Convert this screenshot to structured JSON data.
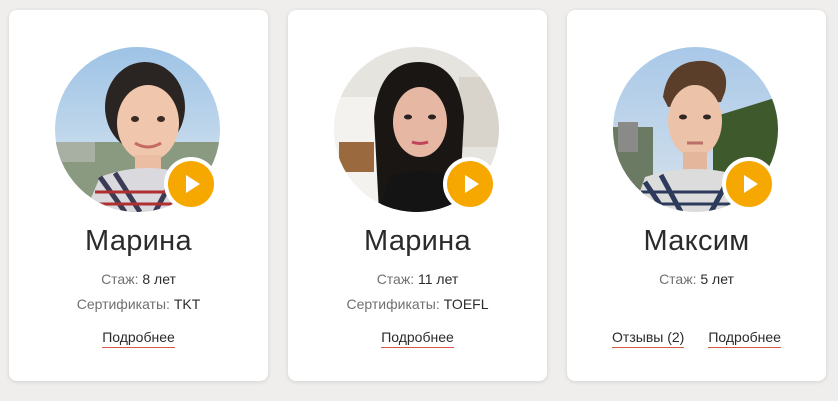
{
  "teachers": [
    {
      "name": "Марина",
      "experience_label": "Стаж:",
      "experience_value": "8 лет",
      "certificates_label": "Сертификаты:",
      "certificates_value": "TKT",
      "details_link": "Подробнее"
    },
    {
      "name": "Марина",
      "experience_label": "Стаж:",
      "experience_value": "11 лет",
      "certificates_label": "Сертификаты:",
      "certificates_value": "TOEFL",
      "details_link": "Подробнее"
    },
    {
      "name": "Максим",
      "experience_label": "Стаж:",
      "experience_value": "5 лет",
      "reviews_link": "Отзывы (2)",
      "details_link": "Подробнее"
    }
  ],
  "colors": {
    "play_button": "#f7a800",
    "link_underline": "#d8584a",
    "page_background": "#efeeec"
  },
  "icons": {
    "play": "play-icon"
  }
}
